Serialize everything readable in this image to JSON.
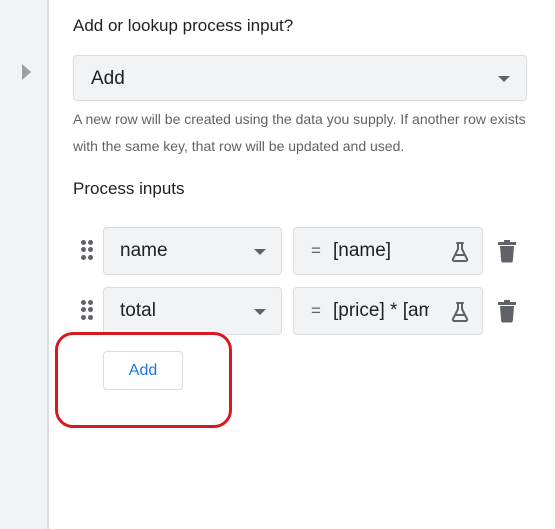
{
  "lookup_section": {
    "heading": "Add or lookup process input?",
    "selected_mode": "Add",
    "help_text": "A new row will be created using the data you supply. If another row exists with the same key, that row will be updated and used."
  },
  "process_inputs": {
    "heading": "Process inputs",
    "rows": [
      {
        "key": "name",
        "equals": "=",
        "expression": "[name]"
      },
      {
        "key": "total",
        "equals": "=",
        "expression": "[price] * [amount]"
      }
    ],
    "add_label": "Add"
  },
  "icons": {
    "drag": "drag-handle-icon",
    "test": "flask-icon",
    "delete": "trash-icon",
    "expand": "chevron-right-icon"
  },
  "colors": {
    "accent": "#1a73e8",
    "annotation": "#d71920"
  }
}
